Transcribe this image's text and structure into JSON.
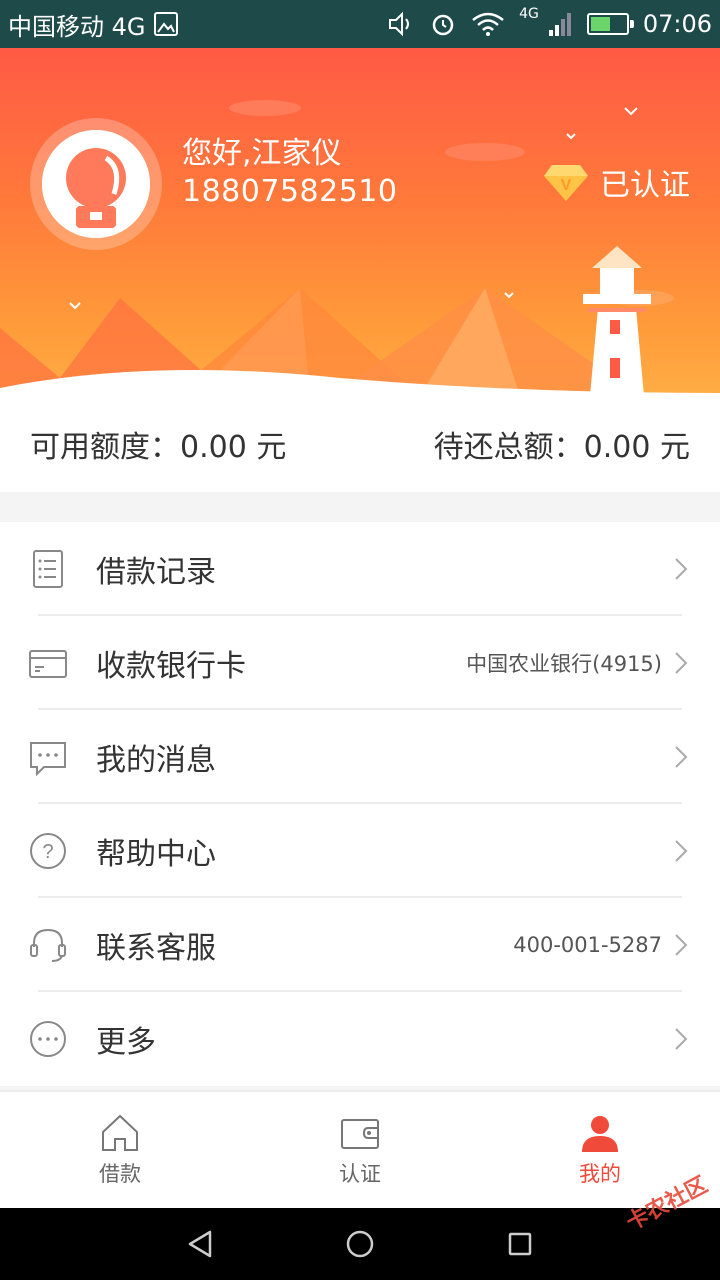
{
  "status_bar": {
    "carrier": "中国移动 4G",
    "network_badge": "4G",
    "time": "07:06",
    "battery_level": 0.56,
    "icons": [
      "image-icon",
      "volume-icon",
      "alarm-icon",
      "wifi-icon",
      "signal-icon",
      "battery-icon"
    ]
  },
  "profile": {
    "greeting": "您好,江家仪",
    "phone": "18807582510",
    "verified_label": "已认证",
    "avatar_icon": "avatar-icon",
    "badge_icon": "diamond-v-icon"
  },
  "balance": {
    "available_label": "可用额度：",
    "available_value": "0.00 元",
    "due_label": "待还总额：",
    "due_value": "0.00 元"
  },
  "menu": {
    "items": [
      {
        "label": "借款记录",
        "extra": "",
        "icon": "list-record-icon"
      },
      {
        "label": "收款银行卡",
        "extra": "中国农业银行(4915)",
        "icon": "bank-card-icon"
      },
      {
        "label": "我的消息",
        "extra": "",
        "icon": "message-icon"
      },
      {
        "label": "帮助中心",
        "extra": "",
        "icon": "help-icon"
      },
      {
        "label": "联系客服",
        "extra": "400-001-5287",
        "icon": "headset-icon"
      },
      {
        "label": "更多",
        "extra": "",
        "icon": "more-icon"
      }
    ]
  },
  "bottom_nav": {
    "items": [
      {
        "label": "借款",
        "icon": "home-icon",
        "active": false
      },
      {
        "label": "认证",
        "icon": "wallet-icon",
        "active": false
      },
      {
        "label": "我的",
        "icon": "user-icon",
        "active": true
      }
    ]
  },
  "watermark": "卡农社区",
  "colors": {
    "accent": "#f04a3a",
    "header_top": "#ff5a45",
    "header_bottom": "#ffad45",
    "status_bar": "#1f4a4a"
  }
}
